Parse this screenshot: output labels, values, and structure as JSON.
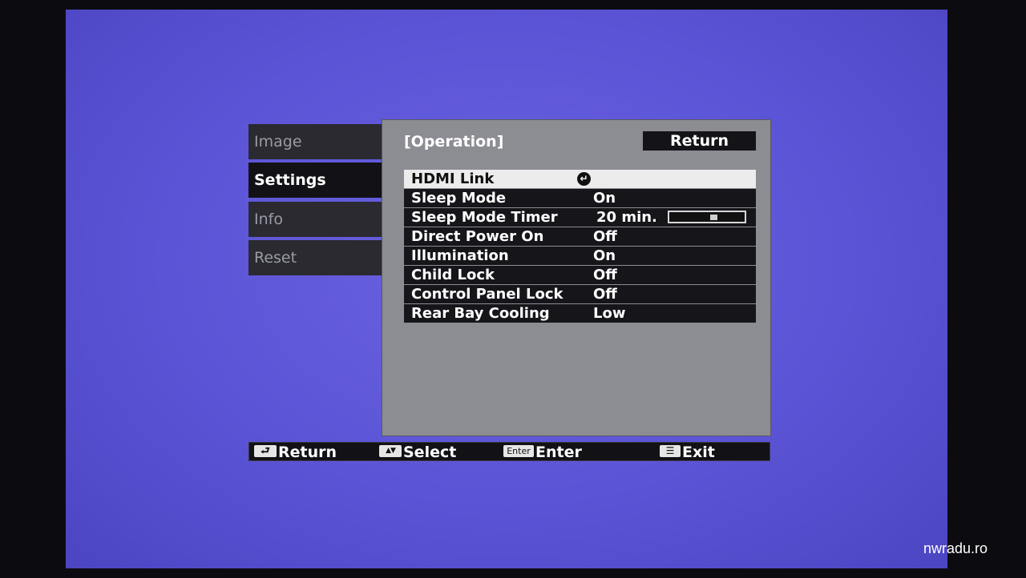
{
  "sidebar": {
    "items": [
      {
        "label": "Image"
      },
      {
        "label": "Settings"
      },
      {
        "label": "Info"
      },
      {
        "label": "Reset"
      }
    ],
    "active_index": 1
  },
  "panel": {
    "title": "[Operation]",
    "return_label": "Return",
    "rows": [
      {
        "label": "HDMI Link",
        "value": "",
        "icon": "enter-arrow-icon"
      },
      {
        "label": "Sleep Mode",
        "value": "On"
      },
      {
        "label": "Sleep Mode Timer",
        "value": "20 min.",
        "slider_fraction": 0.6
      },
      {
        "label": "Direct Power On",
        "value": "Off"
      },
      {
        "label": "Illumination",
        "value": "On"
      },
      {
        "label": "Child Lock",
        "value": "Off"
      },
      {
        "label": "Control Panel Lock",
        "value": "Off"
      },
      {
        "label": "Rear Bay Cooling",
        "value": "Low"
      }
    ]
  },
  "guide": {
    "return_label": "Return",
    "select_label": "Select",
    "enter_key": "Enter",
    "enter_label": "Enter",
    "exit_label": "Exit"
  },
  "watermark": "nwradu.ro",
  "colors": {
    "background": "#5b54d6",
    "panel": "#8c8c93",
    "row": "#15151a",
    "selected_row": "#ececec"
  }
}
